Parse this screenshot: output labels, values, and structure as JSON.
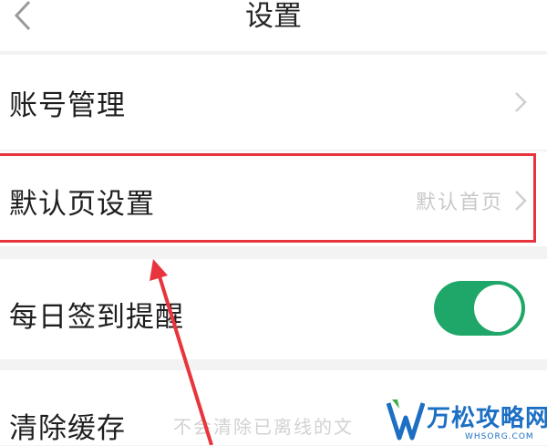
{
  "header": {
    "title": "设置",
    "back_icon": "chevron-left-icon"
  },
  "rows": [
    {
      "label": "账号管理",
      "value": "",
      "control": "chevron-right-icon"
    },
    {
      "label": "默认页设置",
      "value": "默认首页",
      "control": "chevron-right-icon"
    },
    {
      "label": "每日签到提醒",
      "value": "",
      "control": "toggle",
      "toggle_on": true
    },
    {
      "label": "清除缓存",
      "value": "不会清除已离线的文"
    }
  ],
  "watermark": {
    "text": "万松攻略网",
    "subtext": "WHSORG.COM"
  },
  "colors": {
    "toggle_on": "#1fa769",
    "highlight": "#e8353d",
    "watermark": "#1d6fc4"
  }
}
